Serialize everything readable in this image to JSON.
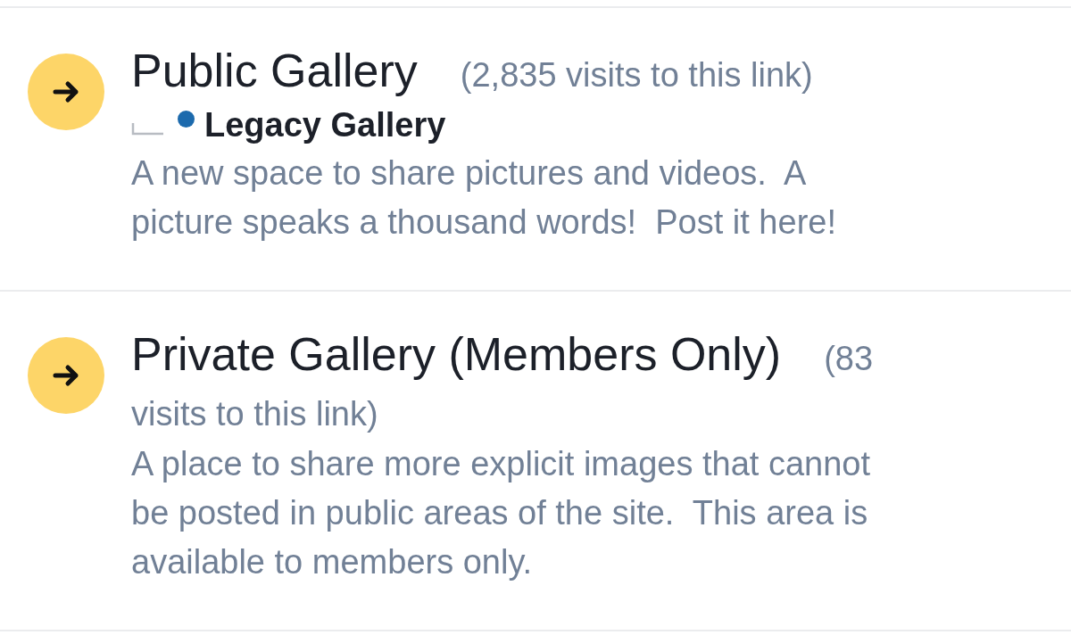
{
  "nodes": [
    {
      "title": "Public Gallery",
      "visits": "(2,835 visits to this link)",
      "subnodes": [
        {
          "title": "Legacy Gallery",
          "unread": true
        }
      ],
      "description": "A new space to share pictures and videos.  A picture speaks a thousand words!  Post it here!"
    },
    {
      "title": "Private Gallery (Members Only)",
      "visits": "(83 visits to this link)",
      "description": "A place to share more explicit images that cannot be posted in public areas of the site.  This area is available to members only."
    }
  ]
}
